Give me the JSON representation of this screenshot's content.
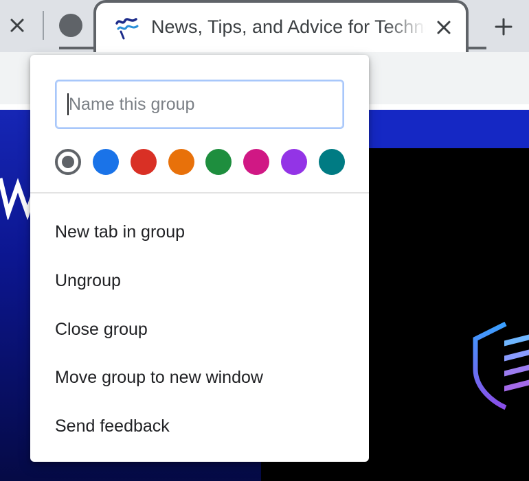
{
  "tab_strip": {
    "active_tab_title": "News, Tips, and Advice for Technology Professionals",
    "icons": {
      "previous_tab_close": "close-icon",
      "group_chip": "tab-group-dot-icon",
      "favicon": "site-favicon-icon",
      "active_tab_close": "close-icon",
      "new_tab": "plus-icon"
    },
    "group_color": "#5f6368"
  },
  "group_editor": {
    "name_input": {
      "value": "",
      "placeholder": "Name this group"
    },
    "colors": [
      {
        "name": "grey",
        "hex": "#5f6368",
        "selected": true
      },
      {
        "name": "blue",
        "hex": "#1a73e8",
        "selected": false
      },
      {
        "name": "red",
        "hex": "#d93025",
        "selected": false
      },
      {
        "name": "yellow",
        "hex": "#e8710a",
        "selected": false
      },
      {
        "name": "green",
        "hex": "#1e8e3e",
        "selected": false
      },
      {
        "name": "pink",
        "hex": "#d01884",
        "selected": false
      },
      {
        "name": "purple",
        "hex": "#9334e6",
        "selected": false
      },
      {
        "name": "cyan",
        "hex": "#007b83",
        "selected": false
      }
    ],
    "menu_items": [
      "New tab in group",
      "Ungroup",
      "Close group",
      "Move group to new window",
      "Send feedback"
    ]
  },
  "page": {
    "logo_icon": "shield-logo-icon"
  }
}
